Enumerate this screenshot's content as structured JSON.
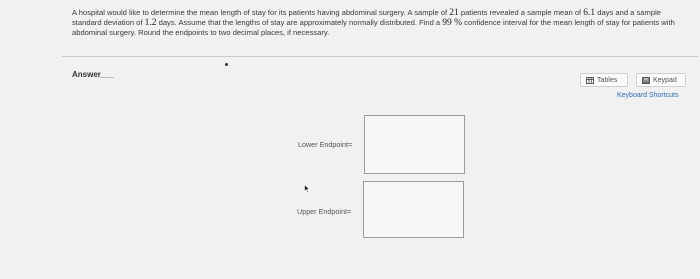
{
  "question": {
    "part1": "A hospital would like to determine the mean length of stay for its patients having abdominal surgery. A sample of ",
    "sample_size": "21",
    "part2": " patients revealed a sample mean of ",
    "sample_mean": "6.1",
    "part3": " days and a sample standard deviation of ",
    "sample_sd": "1.2",
    "part4": " days. Assume that the lengths of stay are approximately normally distributed. Find a ",
    "confidence": "99 %",
    "part5": " confidence interval for the mean length of stay for patients with abdominal surgery. Round the endpoints to two decimal places, if necessary."
  },
  "answer": {
    "label": "Answer"
  },
  "toolbar": {
    "tables_label": "Tables",
    "keypad_label": "Keypad",
    "shortcuts_label": "Keyboard Shortcuts"
  },
  "fields": {
    "lower_label": "Lower Endpoint=",
    "upper_label": "Upper Endpoint="
  },
  "colors": {
    "link": "#2f6bb3",
    "background": "#f1f1f1"
  },
  "icons": {
    "tables": "table-icon",
    "keypad": "keypad-icon",
    "cursor": "mouse-cursor-icon"
  }
}
